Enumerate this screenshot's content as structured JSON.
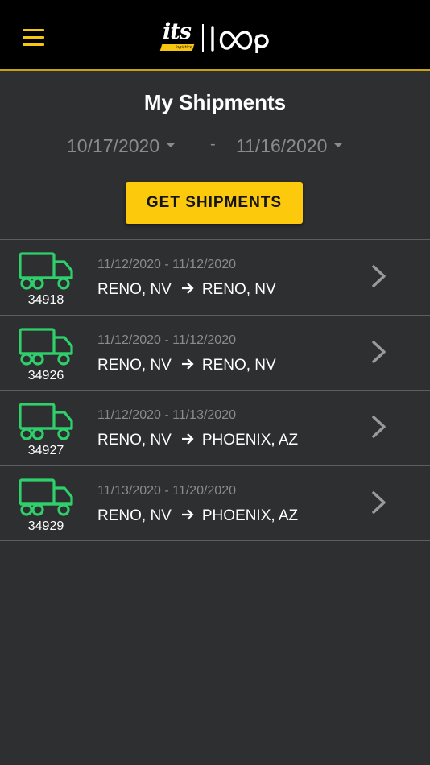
{
  "header": {
    "menu_icon": "hamburger-menu-icon",
    "logo": {
      "brand": "its",
      "brand_sub": "logistics",
      "product": "loop"
    },
    "accent_color": "#f5c50f",
    "border_color": "#c9a20f"
  },
  "page": {
    "title": "My Shipments",
    "date_from": "10/17/2020",
    "date_separator": "-",
    "date_to": "11/16/2020",
    "get_button_label": "GET SHIPMENTS",
    "button_color": "#fcc90d",
    "truck_icon_color": "#2fd06b"
  },
  "shipments": [
    {
      "number": "34918",
      "dates": "11/12/2020 - 11/12/2020",
      "origin": "RENO, NV",
      "destination": "RENO, NV"
    },
    {
      "number": "34926",
      "dates": "11/12/2020 - 11/12/2020",
      "origin": "RENO, NV",
      "destination": "RENO, NV"
    },
    {
      "number": "34927",
      "dates": "11/12/2020 - 11/13/2020",
      "origin": "RENO, NV",
      "destination": "PHOENIX, AZ"
    },
    {
      "number": "34929",
      "dates": "11/13/2020 - 11/20/2020",
      "origin": "RENO, NV",
      "destination": "PHOENIX, AZ"
    }
  ]
}
